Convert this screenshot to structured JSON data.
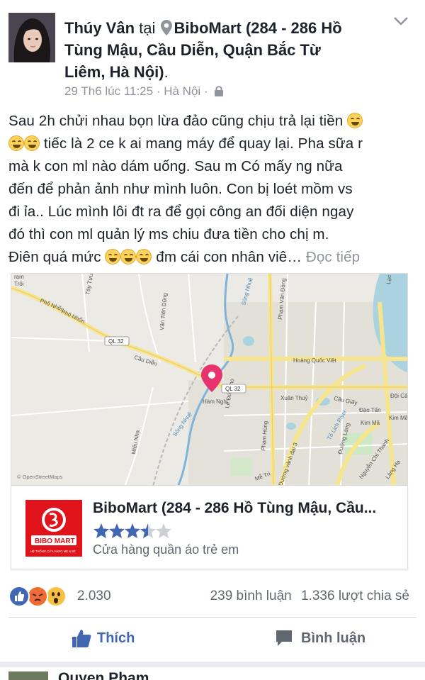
{
  "post": {
    "author": "Thúy Vân",
    "at_word": "tại",
    "location_name": "BiboMart (284 - 286 Hồ Tùng Mậu, Cầu Diễn, Quận Bắc Từ Liêm, Hà Nội)",
    "location_line1": "BiboMart (284 - 286 Hồ",
    "location_line2": "Tùng Mậu, Cầu Diễn, Quận Bắc Từ",
    "location_line3": "Liêm, Hà Nội)",
    "period": ".",
    "timestamp": "29 Th6 lúc 11:25",
    "separator": "·",
    "place": "Hà Nội",
    "body_lines": [
      "Sau 2h chửi nhau bọn lừa đảo cũng chịu trả lại tiền",
      "tiếc là 2 ce k ai mang máy để quay lại. Pha sữa r",
      "mà k con ml nào dám uống. Sau m Có mấy ng nữa",
      "đến để phản ảnh như mình luôn. Con bị loét mồm vs",
      "đi ỉa.. Lúc mình lôi đt ra để gọi công an đối diện ngay",
      "đó thì con ml quản lý ms chiu đưa tiền cho chị m.",
      "Điên quá mức",
      "đm cái con nhân viê…"
    ],
    "read_more": "Đọc tiếp"
  },
  "map": {
    "attribution": "© OpenStreetMaps",
    "labels": {
      "tram_troi_1": "rạm",
      "tram_troi_2": "Trôi",
      "pho_nhon": "Phố Nhổn",
      "pho_nhon2": "Phố Nhổn",
      "tay_tuu": "Tây Tựu",
      "van_tien_dung": "Văn Tiến Dũng",
      "song_nhue_top": "Sông Nhuệ",
      "pham_van_dong": "Phạm Văn Đồng",
      "lac_long": "Lạc Lo",
      "ql32_left": "QL 32",
      "ql32_mid": "QL 32",
      "cau_dien": "Cầu Diễn",
      "hoang_quoc_viet": "Hoàng Quốc Việt",
      "xuan_thuy": "Xuân Thuỷ",
      "cau_giay": "Cầu Giấy",
      "doi_can": "Đội Cấn",
      "dao_tan": "Đào Tấn",
      "kim_ma": "Kim Mã",
      "kim_ma2": "Kim Mã",
      "to_lich": "Tô Lịch River",
      "ham_nghi": "Hàm Nghi",
      "le_duc_tho": "Lê Đức Thọ",
      "song_nhue_bottom": "Sông Nhuệ",
      "mieu_nha": "Miếu Nha",
      "pham_hung": "Phạm Hùng",
      "duong_lang": "Đường Láng",
      "nguyen_chi_thanh": "Nguyễn Chí Thanh",
      "lang_ha": "Láng Hạ",
      "duong_vanh_dai": "Đường vành đai 3",
      "me_tri": "Mễ Trì"
    }
  },
  "place_card": {
    "name": "BiboMart (284 - 286 Hồ Tùng Mậu, Cầu...",
    "logo_text": "BIBO MART",
    "logo_subtext": "HỆ THỐNG CỬA HÀNG MẸ & BÉ",
    "rating": 3.5,
    "rating_max": 5,
    "category": "Cửa hàng quần áo trẻ em"
  },
  "engagement": {
    "reaction_count": "2.030",
    "comments": "239 bình luận",
    "shares": "1.336 lượt chia sẻ"
  },
  "actions": {
    "like_label": "Thích",
    "comment_label": "Bình luận"
  },
  "next_post": {
    "author": "Quyen Pham"
  },
  "colors": {
    "link_blue": "#4267b2",
    "pin_pink": "#e8336f",
    "logo_red": "#e0131b",
    "star_blue": "#4267b2"
  }
}
